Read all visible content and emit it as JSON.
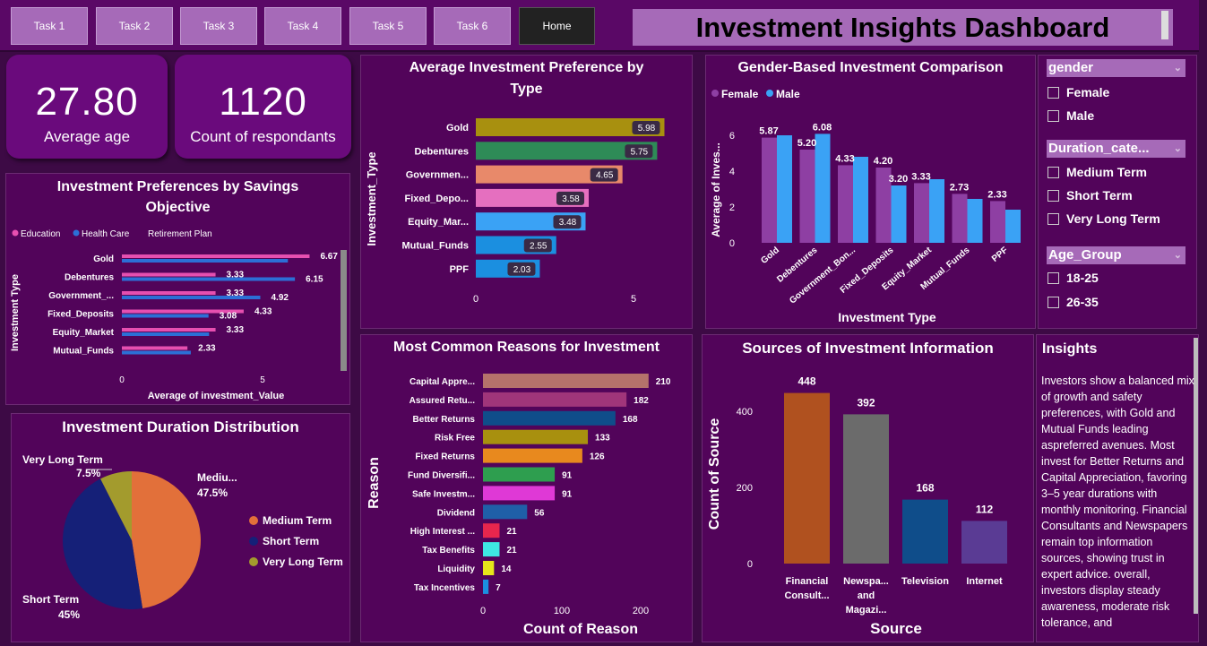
{
  "nav": {
    "tasks": [
      "Task 1",
      "Task 2",
      "Task 3",
      "Task 4",
      "Task 5",
      "Task 6"
    ],
    "home": "Home"
  },
  "title": "Investment Insights Dashboard",
  "kpis": {
    "avg_age": {
      "value": "27.80",
      "label": "Average age"
    },
    "count": {
      "value": "1120",
      "label": "Count of respondants"
    }
  },
  "savings_chart": {
    "title_line1": "Investment Preferences by Savings",
    "title_line2": "Objective",
    "legend": [
      "Education",
      "Health Care",
      "Retirement Plan"
    ],
    "ylabel": "Investment Type",
    "xlabel": "Average of investment_Value",
    "ticks": [
      "0",
      "5"
    ]
  },
  "pref_chart": {
    "title_line1": "Average Investment Preference by",
    "title_line2": "Type",
    "ylabel": "Investment_Type",
    "ticks": [
      "0",
      "5"
    ]
  },
  "gender_chart": {
    "title": "Gender-Based Investment Comparison",
    "legend": [
      "Female",
      "Male"
    ],
    "ylabel": "Average of Inves...",
    "xlabel": "Investment Type",
    "yticks": [
      "0",
      "2",
      "4",
      "6"
    ]
  },
  "duration_chart": {
    "title": "Investment Duration Distribution",
    "legend": [
      "Medium Term",
      "Short Term",
      "Very Long Term"
    ],
    "labels": {
      "vlt_name": "Very Long Term",
      "vlt_pct": "7.5%",
      "med_name": "Mediu...",
      "med_pct": "47.5%",
      "short_name": "Short Term",
      "short_pct": "45%"
    }
  },
  "reasons_chart": {
    "title": "Most Common Reasons for Investment",
    "ylabel": "Reason",
    "xlabel": "Count of Reason",
    "ticks": [
      "0",
      "100",
      "200"
    ]
  },
  "sources_chart": {
    "title": "Sources of Investment Information",
    "ylabel": "Count of Source",
    "xlabel": "Source",
    "yticks": [
      "0",
      "200",
      "400"
    ]
  },
  "slicers": {
    "gender": {
      "title": "gender",
      "options": [
        "Female",
        "Male"
      ]
    },
    "duration": {
      "title": "Duration_cate...",
      "options": [
        "Medium Term",
        "Short Term",
        "Very Long Term"
      ]
    },
    "age": {
      "title": "Age_Group",
      "options": [
        "18-25",
        "26-35"
      ]
    }
  },
  "insights": {
    "title": "Insights",
    "text": "Investors show a balanced mix of growth and safety preferences, with Gold and Mutual Funds leading aspreferred avenues. Most invest for Better Returns and Capital Appreciation, favoring 3–5 year durations with monthly monitoring. Financial Consultants and Newspapers remain top information sources, showing trust in expert advice. overall, investors display steady awareness, moderate risk tolerance, and"
  },
  "colors": {
    "education": "#e64fb0",
    "health": "#2c6fd6",
    "female": "#8e3fa3",
    "male": "#3aa2f5",
    "accent": "#a66ab8"
  },
  "chart_data": [
    {
      "type": "bar",
      "title": "Investment Preferences by Savings Objective",
      "categories": [
        "Gold",
        "Debentures",
        "Government_...",
        "Fixed_Deposits",
        "Equity_Market",
        "Mutual_Funds"
      ],
      "series": [
        {
          "name": "Education",
          "values": [
            6.67,
            3.33,
            3.33,
            4.33,
            3.33,
            2.33
          ]
        },
        {
          "name": "Health Care",
          "values": [
            5.9,
            6.15,
            4.92,
            3.08,
            3.1,
            2.45
          ]
        }
      ],
      "data_labels": [
        "6.67",
        "3.33",
        "6.15",
        "3.33",
        "4.92",
        "4.33",
        "3.08",
        "3.33",
        "2.33"
      ],
      "xlim": [
        0,
        7.5
      ]
    },
    {
      "type": "bar",
      "title": "Average Investment Preference by Type",
      "categories": [
        "Gold",
        "Debentures",
        "Governmen...",
        "Fixed_Depo...",
        "Equity_Mar...",
        "Mutual_Funds",
        "PPF"
      ],
      "values": [
        5.98,
        5.75,
        4.65,
        3.58,
        3.48,
        2.55,
        2.03
      ],
      "labels": [
        "5.98",
        "5.75",
        "4.65",
        "3.58",
        "3.48",
        "2.55",
        "2.03"
      ],
      "colors": [
        "#a8900f",
        "#2e8b57",
        "#e8896a",
        "#e56fbf",
        "#3aa2f5",
        "#1b8fe0",
        "#1b8fe0"
      ],
      "xlim": [
        0,
        6.5
      ]
    },
    {
      "type": "bar",
      "title": "Gender-Based Investment Comparison",
      "categories": [
        "Gold",
        "Debentures",
        "Government_Bon...",
        "Fixed_Deposits",
        "Equity_Market",
        "Mutual_Funds",
        "PPF"
      ],
      "series": [
        {
          "name": "Female",
          "values": [
            5.87,
            5.2,
            4.33,
            4.2,
            3.33,
            2.73,
            2.33
          ]
        },
        {
          "name": "Male",
          "values": [
            6.0,
            6.08,
            4.8,
            3.2,
            3.55,
            2.45,
            1.85
          ]
        }
      ],
      "labels": [
        [
          "5.87",
          "5.20",
          "4.33",
          "4.20",
          "3.33",
          "2.73",
          "2.33"
        ],
        [
          "6.08",
          "3.20"
        ]
      ],
      "ylim": [
        0,
        7
      ]
    },
    {
      "type": "pie",
      "title": "Investment Duration Distribution",
      "categories": [
        "Medium Term",
        "Short Term",
        "Very Long Term"
      ],
      "values": [
        47.5,
        45,
        7.5
      ],
      "colors": [
        "#e2703a",
        "#152078",
        "#a39b2d"
      ]
    },
    {
      "type": "bar",
      "title": "Most Common Reasons for Investment",
      "categories": [
        "Capital Appre...",
        "Assured Retu...",
        "Better Returns",
        "Risk Free",
        "Fixed Returns",
        "Fund Diversifi...",
        "Safe Investm...",
        "Dividend",
        "High Interest ...",
        "Tax Benefits",
        "Liquidity",
        "Tax Incentives"
      ],
      "values": [
        210,
        182,
        168,
        133,
        126,
        91,
        91,
        56,
        21,
        21,
        14,
        7
      ],
      "labels": [
        "210",
        "182",
        "168",
        "133",
        "126",
        "91",
        "91",
        "56",
        "21",
        "21",
        "14",
        "7"
      ],
      "colors": [
        "#b5726b",
        "#a0357a",
        "#0f4d8a",
        "#a8900f",
        "#e8891e",
        "#2e9e4f",
        "#df39d6",
        "#1f5fa8",
        "#e8264d",
        "#3ee8e3",
        "#e6e61a",
        "#1b8fe0"
      ],
      "xlim": [
        0,
        215
      ]
    },
    {
      "type": "bar",
      "title": "Sources of Investment Information",
      "categories": [
        "Financial Consult...",
        "Newspa... and Magazi...",
        "Television",
        "Internet"
      ],
      "values": [
        448,
        392,
        168,
        112
      ],
      "labels": [
        "448",
        "392",
        "168",
        "112"
      ],
      "colors": [
        "#b0511f",
        "#6b6b6b",
        "#0f4d8a",
        "#5a3b94"
      ],
      "ylim": [
        0,
        500
      ]
    }
  ]
}
